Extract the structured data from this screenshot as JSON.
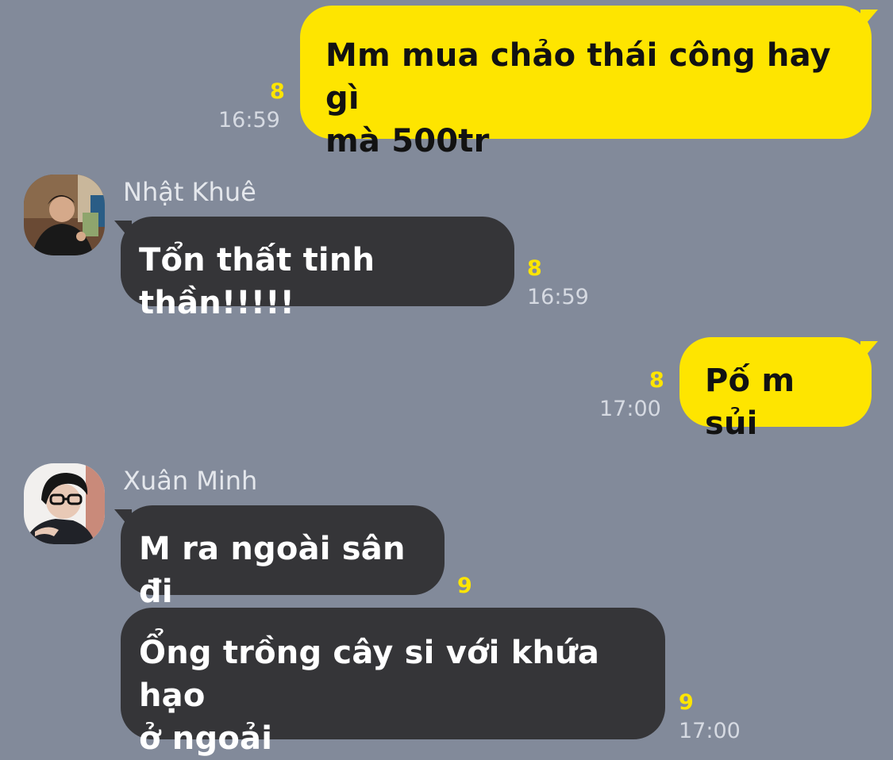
{
  "colors": {
    "background": "#828a9a",
    "outgoing_bubble": "#fee500",
    "incoming_bubble": "#353538",
    "unread_count": "#fee500"
  },
  "messages": [
    {
      "direction": "outgoing",
      "lines": [
        "Mm mua chảo thái công hay gì",
        "mà 500tr"
      ],
      "unread": "8",
      "time": "16:59"
    },
    {
      "direction": "incoming",
      "sender": "Nhật Khuê",
      "avatar": "profile-photo",
      "lines": [
        "Tổn thất tinh thần!!!!!"
      ],
      "unread": "8",
      "time": "16:59"
    },
    {
      "direction": "outgoing",
      "lines": [
        "Pố m sủi"
      ],
      "unread": "8",
      "time": "17:00"
    },
    {
      "direction": "incoming",
      "sender": "Xuân Minh",
      "avatar": "profile-photo",
      "lines": [
        "M ra ngoài sân đi"
      ],
      "unread": "9",
      "time": ""
    },
    {
      "direction": "incoming",
      "lines": [
        "Ổng trồng cây si với khứa hạo",
        "ở ngoải"
      ],
      "unread": "9",
      "time": "17:00"
    }
  ]
}
